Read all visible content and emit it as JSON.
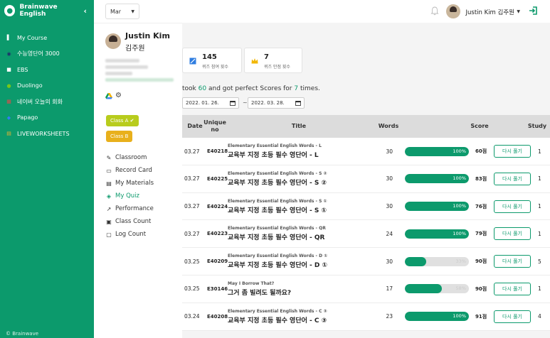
{
  "brand": {
    "name": "Brainwave English",
    "copyright": "© Brainwave"
  },
  "nav": [
    {
      "label": "My Course",
      "color": "#ffffff",
      "glyph": "▌"
    },
    {
      "label": "수능영단어 3000",
      "color": "#1f2f6b",
      "glyph": "◉"
    },
    {
      "label": "EBS",
      "color": "#ffffff",
      "glyph": "■"
    },
    {
      "label": "Duolingo",
      "color": "#77c71a",
      "glyph": "●"
    },
    {
      "label": "네이버 오늘의 회화",
      "color": "#e24a4a",
      "glyph": "▦"
    },
    {
      "label": "Papago",
      "color": "#2f7df6",
      "glyph": "◆"
    },
    {
      "label": "LIVEWORKSHEETS",
      "color": "#f0b430",
      "glyph": "▤"
    }
  ],
  "topbar": {
    "month": "Mar",
    "user_name": "Justin Kim 김주원"
  },
  "profile": {
    "name": "Justin Kim",
    "name_ko": "김주원",
    "class_a": "Class A ✔",
    "class_b": "Class B"
  },
  "menu": [
    {
      "label": "Classroom",
      "icon": "✎",
      "active": false
    },
    {
      "label": "Record Card",
      "icon": "▭",
      "active": false
    },
    {
      "label": "My Materials",
      "icon": "▤",
      "active": false
    },
    {
      "label": "My Quiz",
      "icon": "◈",
      "active": true
    },
    {
      "label": "Performance",
      "icon": "↗",
      "active": false
    },
    {
      "label": "Class Count",
      "icon": "▣",
      "active": false
    },
    {
      "label": "Log Count",
      "icon": "▢",
      "active": false
    }
  ],
  "stats": {
    "attempts_value": "145",
    "attempts_label": "퀴즈 참여 횟수",
    "perfect_value": "7",
    "perfect_label": "퀴즈 만점 횟수"
  },
  "summary": {
    "prefix": "took",
    "count": "60",
    "middle": "and got perfect Scores for",
    "perfect": "7",
    "suffix": "times."
  },
  "dates": {
    "start": "2022. 01. 26.",
    "end": "2022. 03. 28.",
    "separator": "~"
  },
  "table": {
    "headers": {
      "date": "Date",
      "unique_no": "Unique no",
      "title": "Title",
      "words": "Words",
      "score": "Score",
      "study": "Study"
    },
    "retry_label": "다시 풀기",
    "rows": [
      {
        "date": "03.27",
        "no": "E40218",
        "sub": "Elementary Essential English Words - L",
        "title": "교육부 지정 초등 필수 영단어 - L",
        "words": "30",
        "percent": 100,
        "percent_label": "100%",
        "score": "60점",
        "study": "1"
      },
      {
        "date": "03.27",
        "no": "E40225",
        "sub": "Elementary Essential English Words - S ②",
        "title": "교육부 지정 초등 필수 영단어 - S ②",
        "words": "30",
        "percent": 100,
        "percent_label": "100%",
        "score": "83점",
        "study": "1"
      },
      {
        "date": "03.27",
        "no": "E40224",
        "sub": "Elementary Essential English Words - S ①",
        "title": "교육부 지정 초등 필수 영단어 - S ①",
        "words": "30",
        "percent": 100,
        "percent_label": "100%",
        "score": "76점",
        "study": "1"
      },
      {
        "date": "03.27",
        "no": "E40223",
        "sub": "Elementary Essential English Words - QR",
        "title": "교육부 지정 초등 필수 영단어 - QR",
        "words": "24",
        "percent": 100,
        "percent_label": "100%",
        "score": "79점",
        "study": "1"
      },
      {
        "date": "03.25",
        "no": "E40209",
        "sub": "Elementary Essential English Words - D ①",
        "title": "교육부 지정 초등 필수 영단어 - D ①",
        "words": "30",
        "percent": 33,
        "percent_label": "33%",
        "score": "90점",
        "study": "5"
      },
      {
        "date": "03.25",
        "no": "E30146",
        "sub": "May I Borrow That?",
        "title": "그거 좀 빌려도 될까요?",
        "words": "17",
        "percent": 58,
        "percent_label": "58%",
        "score": "90점",
        "study": "1"
      },
      {
        "date": "03.24",
        "no": "E40208",
        "sub": "Elementary Essential English Words - C ③",
        "title": "교육부 지정 초등 필수 영단어 - C ③",
        "words": "23",
        "percent": 100,
        "percent_label": "100%",
        "score": "91점",
        "study": "4"
      }
    ]
  }
}
